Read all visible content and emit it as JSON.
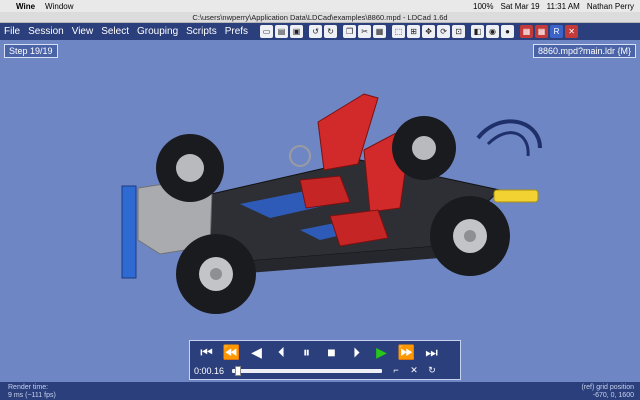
{
  "mac": {
    "app_name": "Wine",
    "menu_window": "Window",
    "battery": "100%",
    "date": "Sat Mar 19",
    "time": "11:31 AM",
    "user": "Nathan Perry"
  },
  "window": {
    "title": "C:\\users\\nwperry\\Application Data\\LDCad\\examples\\8860.mpd - LDCad 1.6d"
  },
  "menu": [
    "File",
    "Session",
    "View",
    "Select",
    "Grouping",
    "Scripts",
    "Prefs"
  ],
  "toolbar_icons": [
    "new-icon",
    "open-icon",
    "save-icon",
    "saveas-icon",
    "undo-icon",
    "redo-icon",
    "copy-icon",
    "cut-icon",
    "paste-icon",
    "delete-icon",
    "group-icon",
    "ungroup-icon",
    "move-icon",
    "rotate-icon",
    "snap-icon",
    "grid-icon",
    "camera-icon",
    "light-icon",
    "color-icon",
    "render-icon",
    "settings-icon",
    "help-icon"
  ],
  "viewport": {
    "step_label": "Step 19/19",
    "model_label": "8860.mpd?main.ldr {M}"
  },
  "player": {
    "time": "0:00.16",
    "progress": 0.02
  },
  "status": {
    "left_label": "Render time:",
    "left_value": "9 ms (~111 fps)",
    "right_label": "(ref) grid position",
    "right_value": "-670, 0, 1600"
  }
}
